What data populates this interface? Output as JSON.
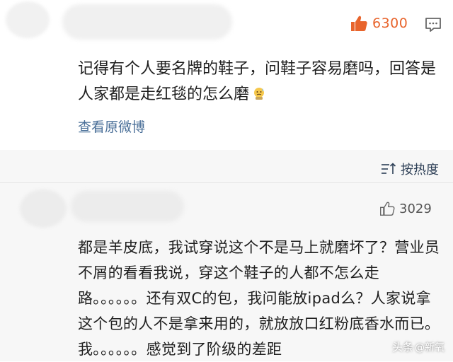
{
  "comment1": {
    "like_count": "6300",
    "text": "记得有个人要名牌的鞋子，问鞋子容易磨吗，回答是人家都是走红毯的怎么磨",
    "view_original_label": "查看原微博"
  },
  "sort": {
    "label": "按热度"
  },
  "comment2": {
    "like_count": "3029",
    "text": "都是羊皮底，我试穿说这个不是马上就磨坏了？营业员不屑的看看我说，穿这个鞋子的人都不怎么走路。。。。。。还有双C的包，我问能放ipad么？人家说拿这个包的人不是拿来用的，就放放口红粉底香水而已。我。。。。。。感觉到了阶级的差距"
  },
  "watermark": {
    "prefix": "头条",
    "author": "@新氧"
  },
  "colors": {
    "like_active": "#e8642c",
    "link": "#4a6f98",
    "sort_bg": "#f7f7f7"
  },
  "icons": {
    "like_active": "thumbs-up-icon",
    "reply": "comment-icon",
    "sort": "sort-icon",
    "like_inactive": "thumbs-up-outline-icon",
    "emoji": "cold-sweat-emoji-icon"
  }
}
